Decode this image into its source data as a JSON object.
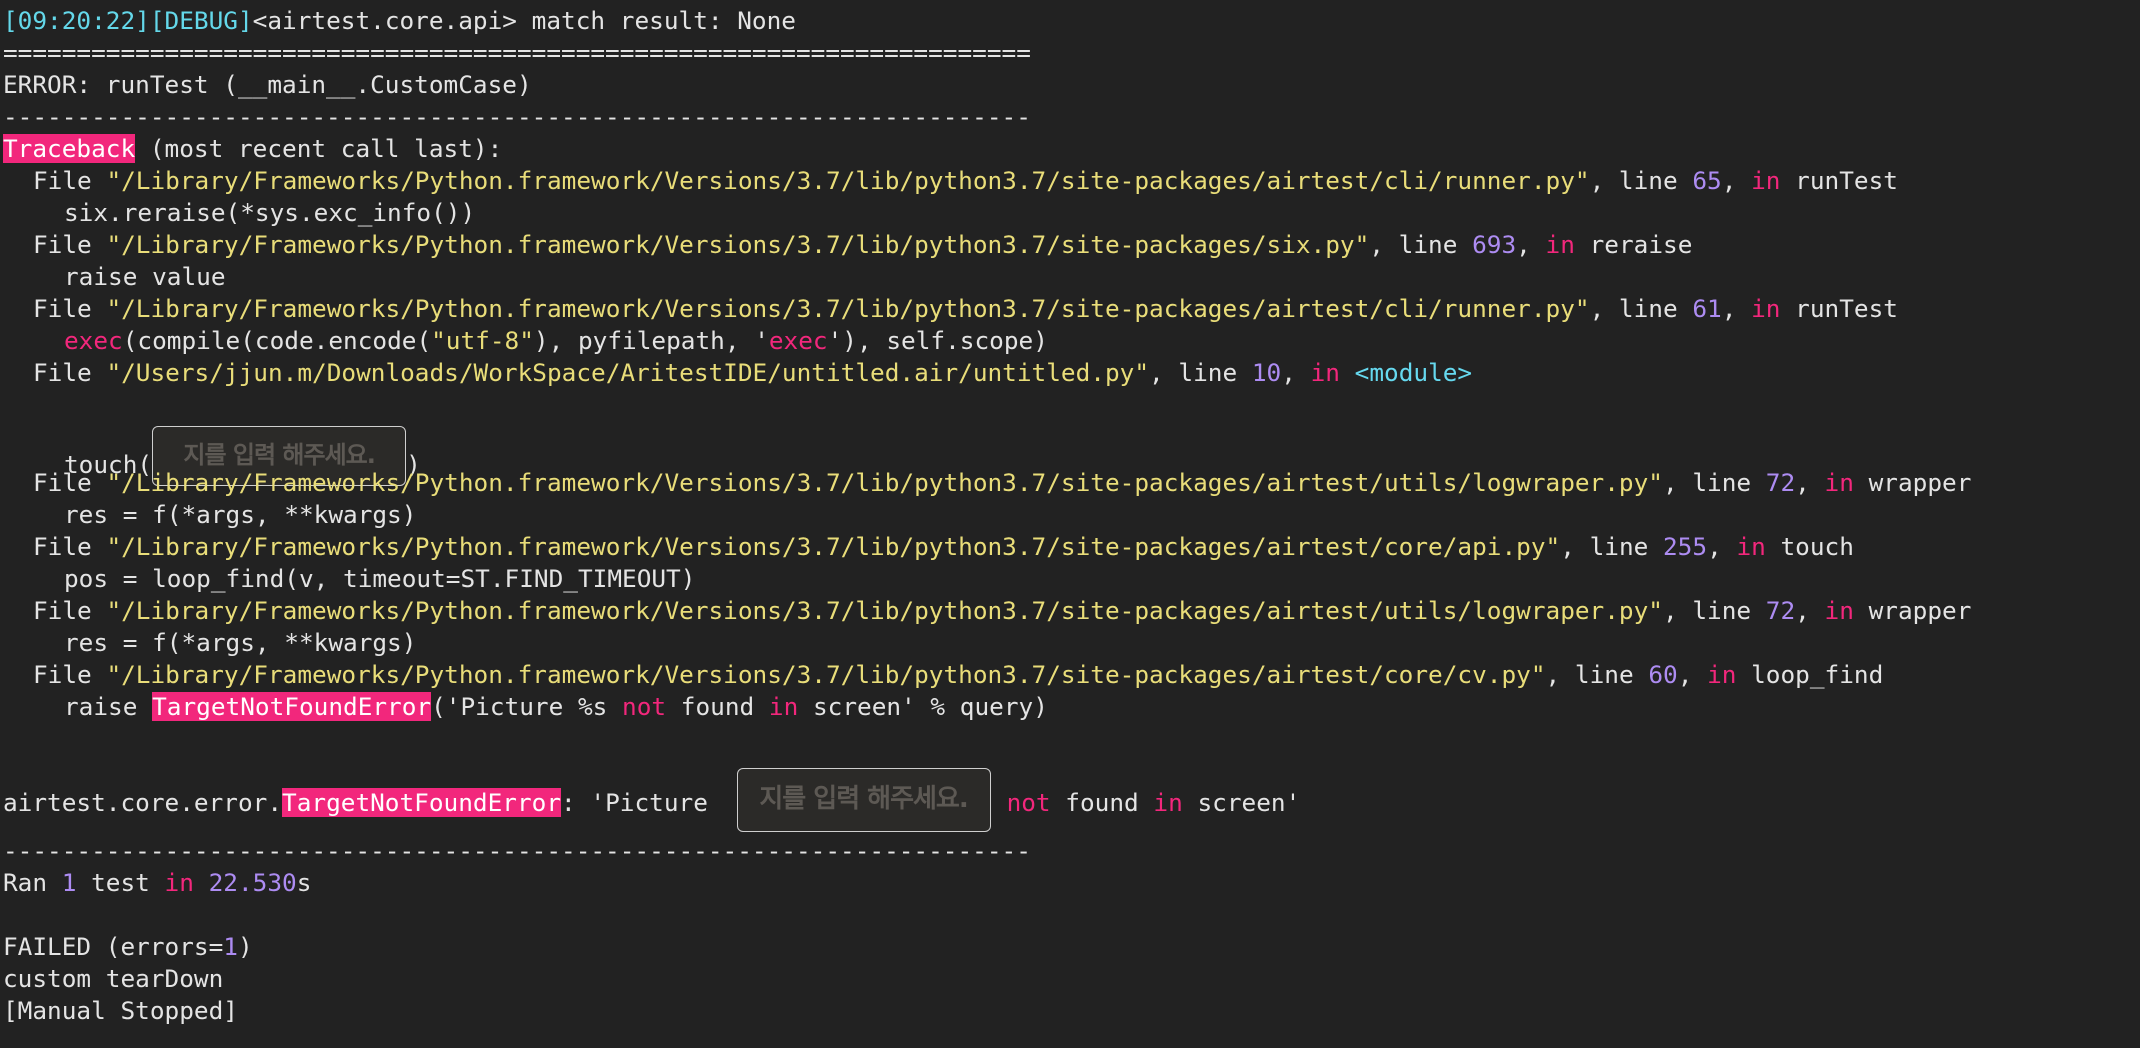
{
  "colors": {
    "background": "#222222",
    "text": "#e4e4e4",
    "timestamp": "#64d8ea",
    "string": "#e9dd79",
    "number": "#ad8cf2",
    "keyword": "#f2277c",
    "highlight_bg": "#f2277c"
  },
  "log": {
    "debug_time": "[09:20:22]",
    "debug_level": "[DEBUG]",
    "debug_msg": "<airtest.core.api> match result: None"
  },
  "separator_double": "======================================================================",
  "separator_single": "----------------------------------------------------------------------",
  "error_header": "ERROR: runTest (__main__.CustomCase)",
  "traceback": {
    "label": "Traceback",
    "rest": " (most recent call last):"
  },
  "words": {
    "file": "File ",
    "line": ", line ",
    "in": "in",
    "not": "not"
  },
  "frames": [
    {
      "path": "\"/Library/Frameworks/Python.framework/Versions/3.7/lib/python3.7/site-packages/airtest/cli/runner.py\"",
      "line": "65",
      "func": "runTest",
      "code": "six.reraise(*sys.exc_info())"
    },
    {
      "path": "\"/Library/Frameworks/Python.framework/Versions/3.7/lib/python3.7/site-packages/six.py\"",
      "line": "693",
      "func": "reraise",
      "code": "raise value"
    },
    {
      "path": "\"/Library/Frameworks/Python.framework/Versions/3.7/lib/python3.7/site-packages/airtest/cli/runner.py\"",
      "line": "61",
      "func": "runTest"
    },
    {
      "path": "\"/Users/jjun.m/Downloads/WorkSpace/AritestIDE/untitled.air/untitled.py\"",
      "line": "10",
      "func": "<module>",
      "code_prefix": "touch(",
      "code_suffix": ")"
    },
    {
      "path": "\"/Library/Frameworks/Python.framework/Versions/3.7/lib/python3.7/site-packages/airtest/utils/logwraper.py\"",
      "line": "72",
      "func": "wrapper",
      "code": "res = f(*args, **kwargs)"
    },
    {
      "path": "\"/Library/Frameworks/Python.framework/Versions/3.7/lib/python3.7/site-packages/airtest/core/api.py\"",
      "line": "255",
      "func": "touch",
      "code": "pos = loop_find(v, timeout=ST.FIND_TIMEOUT)"
    },
    {
      "path": "\"/Library/Frameworks/Python.framework/Versions/3.7/lib/python3.7/site-packages/airtest/utils/logwraper.py\"",
      "line": "72",
      "func": "wrapper",
      "code": "res = f(*args, **kwargs)"
    },
    {
      "path": "\"/Library/Frameworks/Python.framework/Versions/3.7/lib/python3.7/site-packages/airtest/core/cv.py\"",
      "line": "60",
      "func": "loop_find"
    }
  ],
  "exec_line": {
    "exec1": "exec",
    "a": "(compile(code.encode(",
    "utf8": "\"utf-8\"",
    "b": "), pyfilepath, '",
    "exec2": "exec",
    "c": "'), self.scope)"
  },
  "raise_line": {
    "raise": "raise ",
    "err": "TargetNotFoundError",
    "a": "('Picture %s ",
    "b": " found ",
    "c": " screen' % query)"
  },
  "final_error": {
    "prefix": "airtest.core.error.",
    "err": "TargetNotFoundError",
    "msg": ": 'Picture ",
    "mid": " found ",
    "end": " screen'"
  },
  "thumbnail_text": "지를 입력 해주세요.",
  "summary": {
    "ran_prefix": "Ran ",
    "count": "1",
    "test_word": " test ",
    "in_word": "in",
    "time": "22.530",
    "time_unit": "s",
    "failed_prefix": "FAILED (errors=",
    "errors": "1",
    "failed_suffix": ")",
    "teardown": "custom tearDown",
    "stopped": "[Manual Stopped]"
  }
}
